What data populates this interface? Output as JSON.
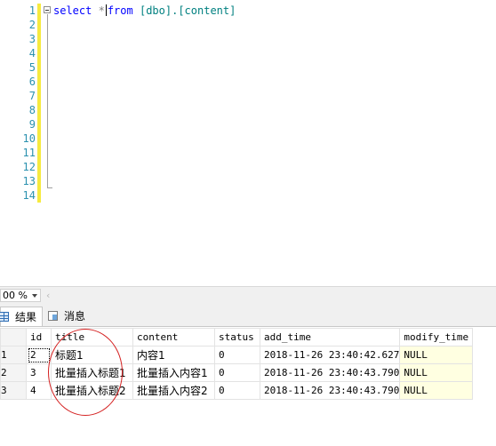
{
  "editor": {
    "line_numbers": [
      "1",
      "2",
      "3",
      "4",
      "5",
      "6",
      "7",
      "8",
      "9",
      "10",
      "11",
      "12",
      "13",
      "14"
    ],
    "code": {
      "select_kw": "select",
      "star": "*",
      "from_kw": "from",
      "object": "[dbo].[content]"
    }
  },
  "zoom": {
    "value": "00 %"
  },
  "hscroll": {
    "left_arrow": "‹"
  },
  "tabs": {
    "results_label": "结果",
    "messages_label": "消息",
    "results_icon": "grid-icon",
    "messages_icon": "message-icon"
  },
  "results": {
    "columns": [
      "id",
      "title",
      "content",
      "status",
      "add_time",
      "modify_time"
    ],
    "rows": [
      {
        "rownum": "1",
        "id": "2",
        "title": "标题1",
        "content": "内容1",
        "status": "0",
        "add_time": "2018-11-26 23:40:42.627",
        "modify_time": "NULL"
      },
      {
        "rownum": "2",
        "id": "3",
        "title": "批量插入标题1",
        "content": "批量插入内容1",
        "status": "0",
        "add_time": "2018-11-26 23:40:43.790",
        "modify_time": "NULL"
      },
      {
        "rownum": "3",
        "id": "4",
        "title": "批量插入标题2",
        "content": "批量插入内容2",
        "status": "0",
        "add_time": "2018-11-26 23:40:43.790",
        "modify_time": "NULL"
      }
    ]
  },
  "colors": {
    "line_number": "#2b91af",
    "keyword": "#0000ff",
    "object": "#008080",
    "change_bar": "#f6ea3f",
    "null_cell": "#ffffe1",
    "annotation_circle": "#d42020"
  }
}
